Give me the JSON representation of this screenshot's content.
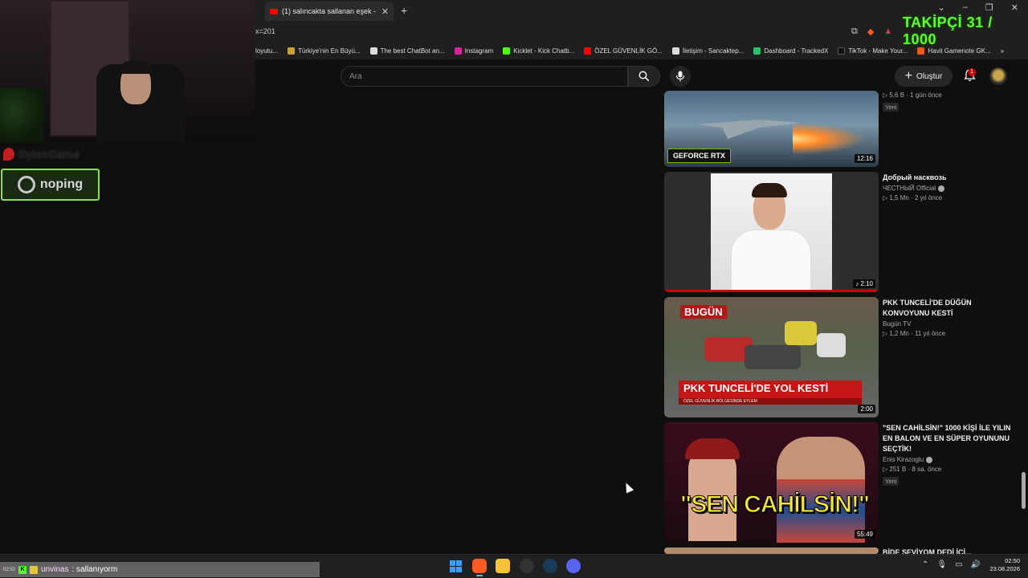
{
  "browser": {
    "active_tab_title": "(1) salıncakta sallanan eşek - You",
    "tab_close": "✕",
    "new_tab": "+",
    "url_fragment": "x=201",
    "bookmarks": [
      {
        "label": "loyutu...",
        "color": "#6a6a6a"
      },
      {
        "label": "Türkiye'nin En Büyü...",
        "color": "#c9a13a"
      },
      {
        "label": "The best ChatBot an...",
        "color": "#dddddd"
      },
      {
        "label": "Instagram",
        "color": "#d6249f"
      },
      {
        "label": "Kicklet - Kick Chatb...",
        "color": "#53fc18"
      },
      {
        "label": "ÖZEL GÜVENLİK GÖ...",
        "color": "#ff0000"
      },
      {
        "label": "İletişim - Sancaktep...",
        "color": "#dddddd"
      },
      {
        "label": "Dashboard - TrackedX",
        "color": "#2fbf71"
      },
      {
        "label": "TikTok - Make Your...",
        "color": "#111111"
      },
      {
        "label": "Havit Gamenote GK...",
        "color": "#e85b1a"
      }
    ],
    "bookmarks_more": "»"
  },
  "overlay": {
    "brand_text": "GylexGame",
    "sponsor": "noping",
    "follower_goal": "TAKİPÇİ 31 / 1000"
  },
  "youtube": {
    "search_placeholder": "Ara",
    "create_label": "Oluştur",
    "notifications_count": "1"
  },
  "videos": [
    {
      "title": "",
      "channel": "",
      "stats": "▷ 5,6 B · 1 gün önce",
      "badge": "Yeni",
      "duration": "12:16",
      "thumb_text": "GEFORCE RTX"
    },
    {
      "title": "Добрый насквозь",
      "channel": "ЧЕСТНЫЙ Official",
      "verified": true,
      "stats": "▷ 1,5 Mn · 2 yıl önce",
      "duration": "♪ 2:10"
    },
    {
      "title": "PKK TUNCELİ'DE DÜĞÜN KONVOYUNU KESTİ",
      "channel": "Bugün TV",
      "stats": "▷ 1,2 Mn · 11 yıl önce",
      "duration": "2:00",
      "thumb_logo": "BUGÜN",
      "thumb_headline": "PKK TUNCELİ'DE YOL KESTİ",
      "thumb_subline": "ÖZEL GÜVENLİK BÖLGESİNDE EYLEM"
    },
    {
      "title": "\"SEN CAHİLSİN!\" 1000 KİŞİ İLE YILIN EN BALON VE EN SÜPER OYUNUNU SEÇTİK!",
      "channel": "Enis Kirazoglu",
      "verified": true,
      "stats": "▷ 251 B · 8 sa. önce",
      "badge": "Yeni",
      "duration": "55:49",
      "thumb_caption": "\"SEN CAHİLSİN!\""
    },
    {
      "title": "BİDE SEVİYOM DEDİ İÇİ...",
      "channel": "",
      "stats": ""
    }
  ],
  "chat": {
    "time": "02:50",
    "badge": "K",
    "username": "unvinas",
    "message": ": sallanıyorm"
  },
  "taskbar": {
    "clock_time": "02:50",
    "clock_date": "23.08.2026",
    "tray_chevron": "⌃"
  }
}
